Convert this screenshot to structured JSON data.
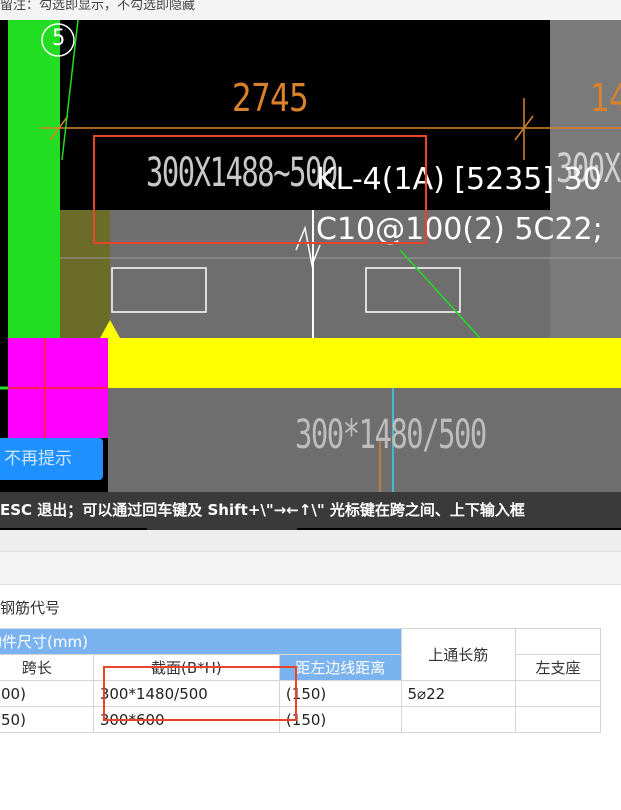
{
  "hint": {
    "text": "留注：勾选即显示，不勾选即隐藏"
  },
  "cad": {
    "axis_marker": "5",
    "dimension_main": "2745",
    "dimension_right": "14",
    "section_label_top": "300X1488~500",
    "section_label_top_right": "300X",
    "beam_label_line1": "KL-4(1A) [5235] 30",
    "beam_label_line2": "C10@100(2) 5C22;",
    "section_label_bottom": "300*1480/500",
    "no_remind_button": "不再提示",
    "status_text": "ESC 退出；可以通过回车键及 Shift+\\\"→←↑\\\" 光标键在跨之间、上下输入框"
  },
  "panel": {
    "rebar_code_label": "钢筋代号",
    "table": {
      "group_header": "构件尺寸(mm)",
      "columns": {
        "span_length": "跨长",
        "section": "截面(B*H)",
        "left_edge_distance": "距左边线距离",
        "top_through_bar": "上通长筋",
        "left_support": "左支座"
      },
      "rows": [
        {
          "span_length": "00)",
          "section": "300*1480/500",
          "left_edge_distance": "(150)",
          "top_through_bar": "5⌀22",
          "left_support": ""
        },
        {
          "span_length": "50)",
          "section": "300*600",
          "left_edge_distance": "(150)",
          "top_through_bar": "",
          "left_support": ""
        }
      ]
    }
  },
  "colors": {
    "accent_blue": "#7bb3f0",
    "highlight_red": "#e8442a",
    "cad_yellow": "#ffff00",
    "cad_green": "#22dd22",
    "cad_magenta": "#ff00ff"
  }
}
